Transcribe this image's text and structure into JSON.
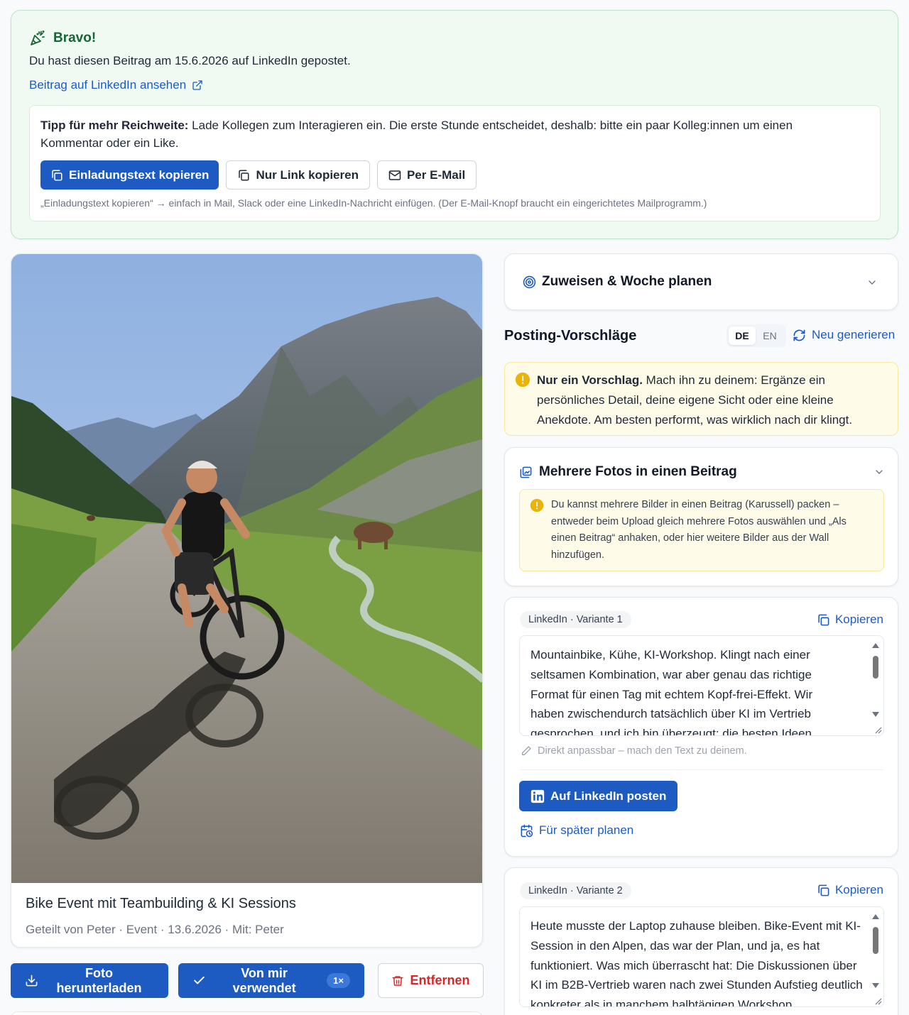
{
  "banner": {
    "title": "Bravo!",
    "message": "Du hast diesen Beitrag am 15.6.2026 auf LinkedIn gepostet.",
    "view_link": "Beitrag auf LinkedIn ansehen",
    "tip_bold": "Tipp für mehr Reichweite:",
    "tip_text": " Lade Kollegen zum Interagieren ein. Die erste Stunde entscheidet, deshalb: bitte ein paar Kolleg:innen um einen Kommentar oder ein Like.",
    "btn_copy_invite": "Einladungstext kopieren",
    "btn_copy_link": "Nur Link kopieren",
    "btn_email": "Per E-Mail",
    "hint": "„Einladungstext kopieren“ → einfach in Mail, Slack oder eine LinkedIn-Nachricht einfügen. (Der E-Mail-Knopf braucht ein eingerichtetes Mailprogramm.)"
  },
  "photo": {
    "title": "Bike Event mit Teambuilding & KI Sessions",
    "meta": "Geteilt von Peter · Event · 13.6.2026 · Mit: Peter"
  },
  "actions": {
    "download": "Foto herunterladen",
    "used": "Von mir verwendet",
    "used_count": "1×",
    "remove": "Entfernen"
  },
  "assign": {
    "title": "Zuweisen & Woche planen"
  },
  "suggestions": {
    "title": "Posting-Vorschläge",
    "lang_de": "DE",
    "lang_en": "EN",
    "regenerate": "Neu generieren",
    "notice_bold": "Nur ein Vorschlag.",
    "notice_text": " Mach ihn zu deinem: Ergänze ein persönliches Detail, deine eigene Sicht oder eine kleine Anekdote. Am besten performt, was wirklich nach dir klingt."
  },
  "multi": {
    "title": "Mehrere Fotos in einen Beitrag",
    "info": "Du kannst mehrere Bilder in einen Beitrag (Karussell) packen – entweder beim Upload gleich mehrere Fotos auswählen und „Als einen Beitrag“ anhaken, oder hier weitere Bilder aus der Wall hinzufügen."
  },
  "variants": [
    {
      "label": "LinkedIn · Variante 1",
      "copy": "Kopieren",
      "text": "Mountainbike, Kühe, KI-Workshop. Klingt nach einer seltsamen Kombination, war aber genau das richtige Format für einen Tag mit echtem Kopf-frei-Effekt. Wir haben zwischendurch tatsächlich über KI im Vertrieb gesprochen, und ich bin überzeugt: die besten Ideen",
      "edit_hint": "Direkt anpassbar – mach den Text zu deinem.",
      "post": "Auf LinkedIn posten",
      "schedule": "Für später planen"
    },
    {
      "label": "LinkedIn · Variante 2",
      "copy": "Kopieren",
      "text": "Heute musste der Laptop zuhause bleiben. Bike-Event mit KI-Session in den Alpen, das war der Plan, und ja, es hat funktioniert. Was mich überrascht hat: Die Diskussionen über KI im B2B-Vertrieb waren nach zwei Stunden Aufstieg deutlich konkreter als in manchem halbtägigen Workshop."
    }
  ],
  "colors": {
    "primary": "#1d5bc2",
    "success_bg": "#f0faf3",
    "success_border": "#bde5c8",
    "success_title": "#166534",
    "warning_bg": "#fefbe8",
    "warning_border": "#fbe7a1",
    "warning_icon": "#eab308",
    "danger": "#dc2626"
  }
}
